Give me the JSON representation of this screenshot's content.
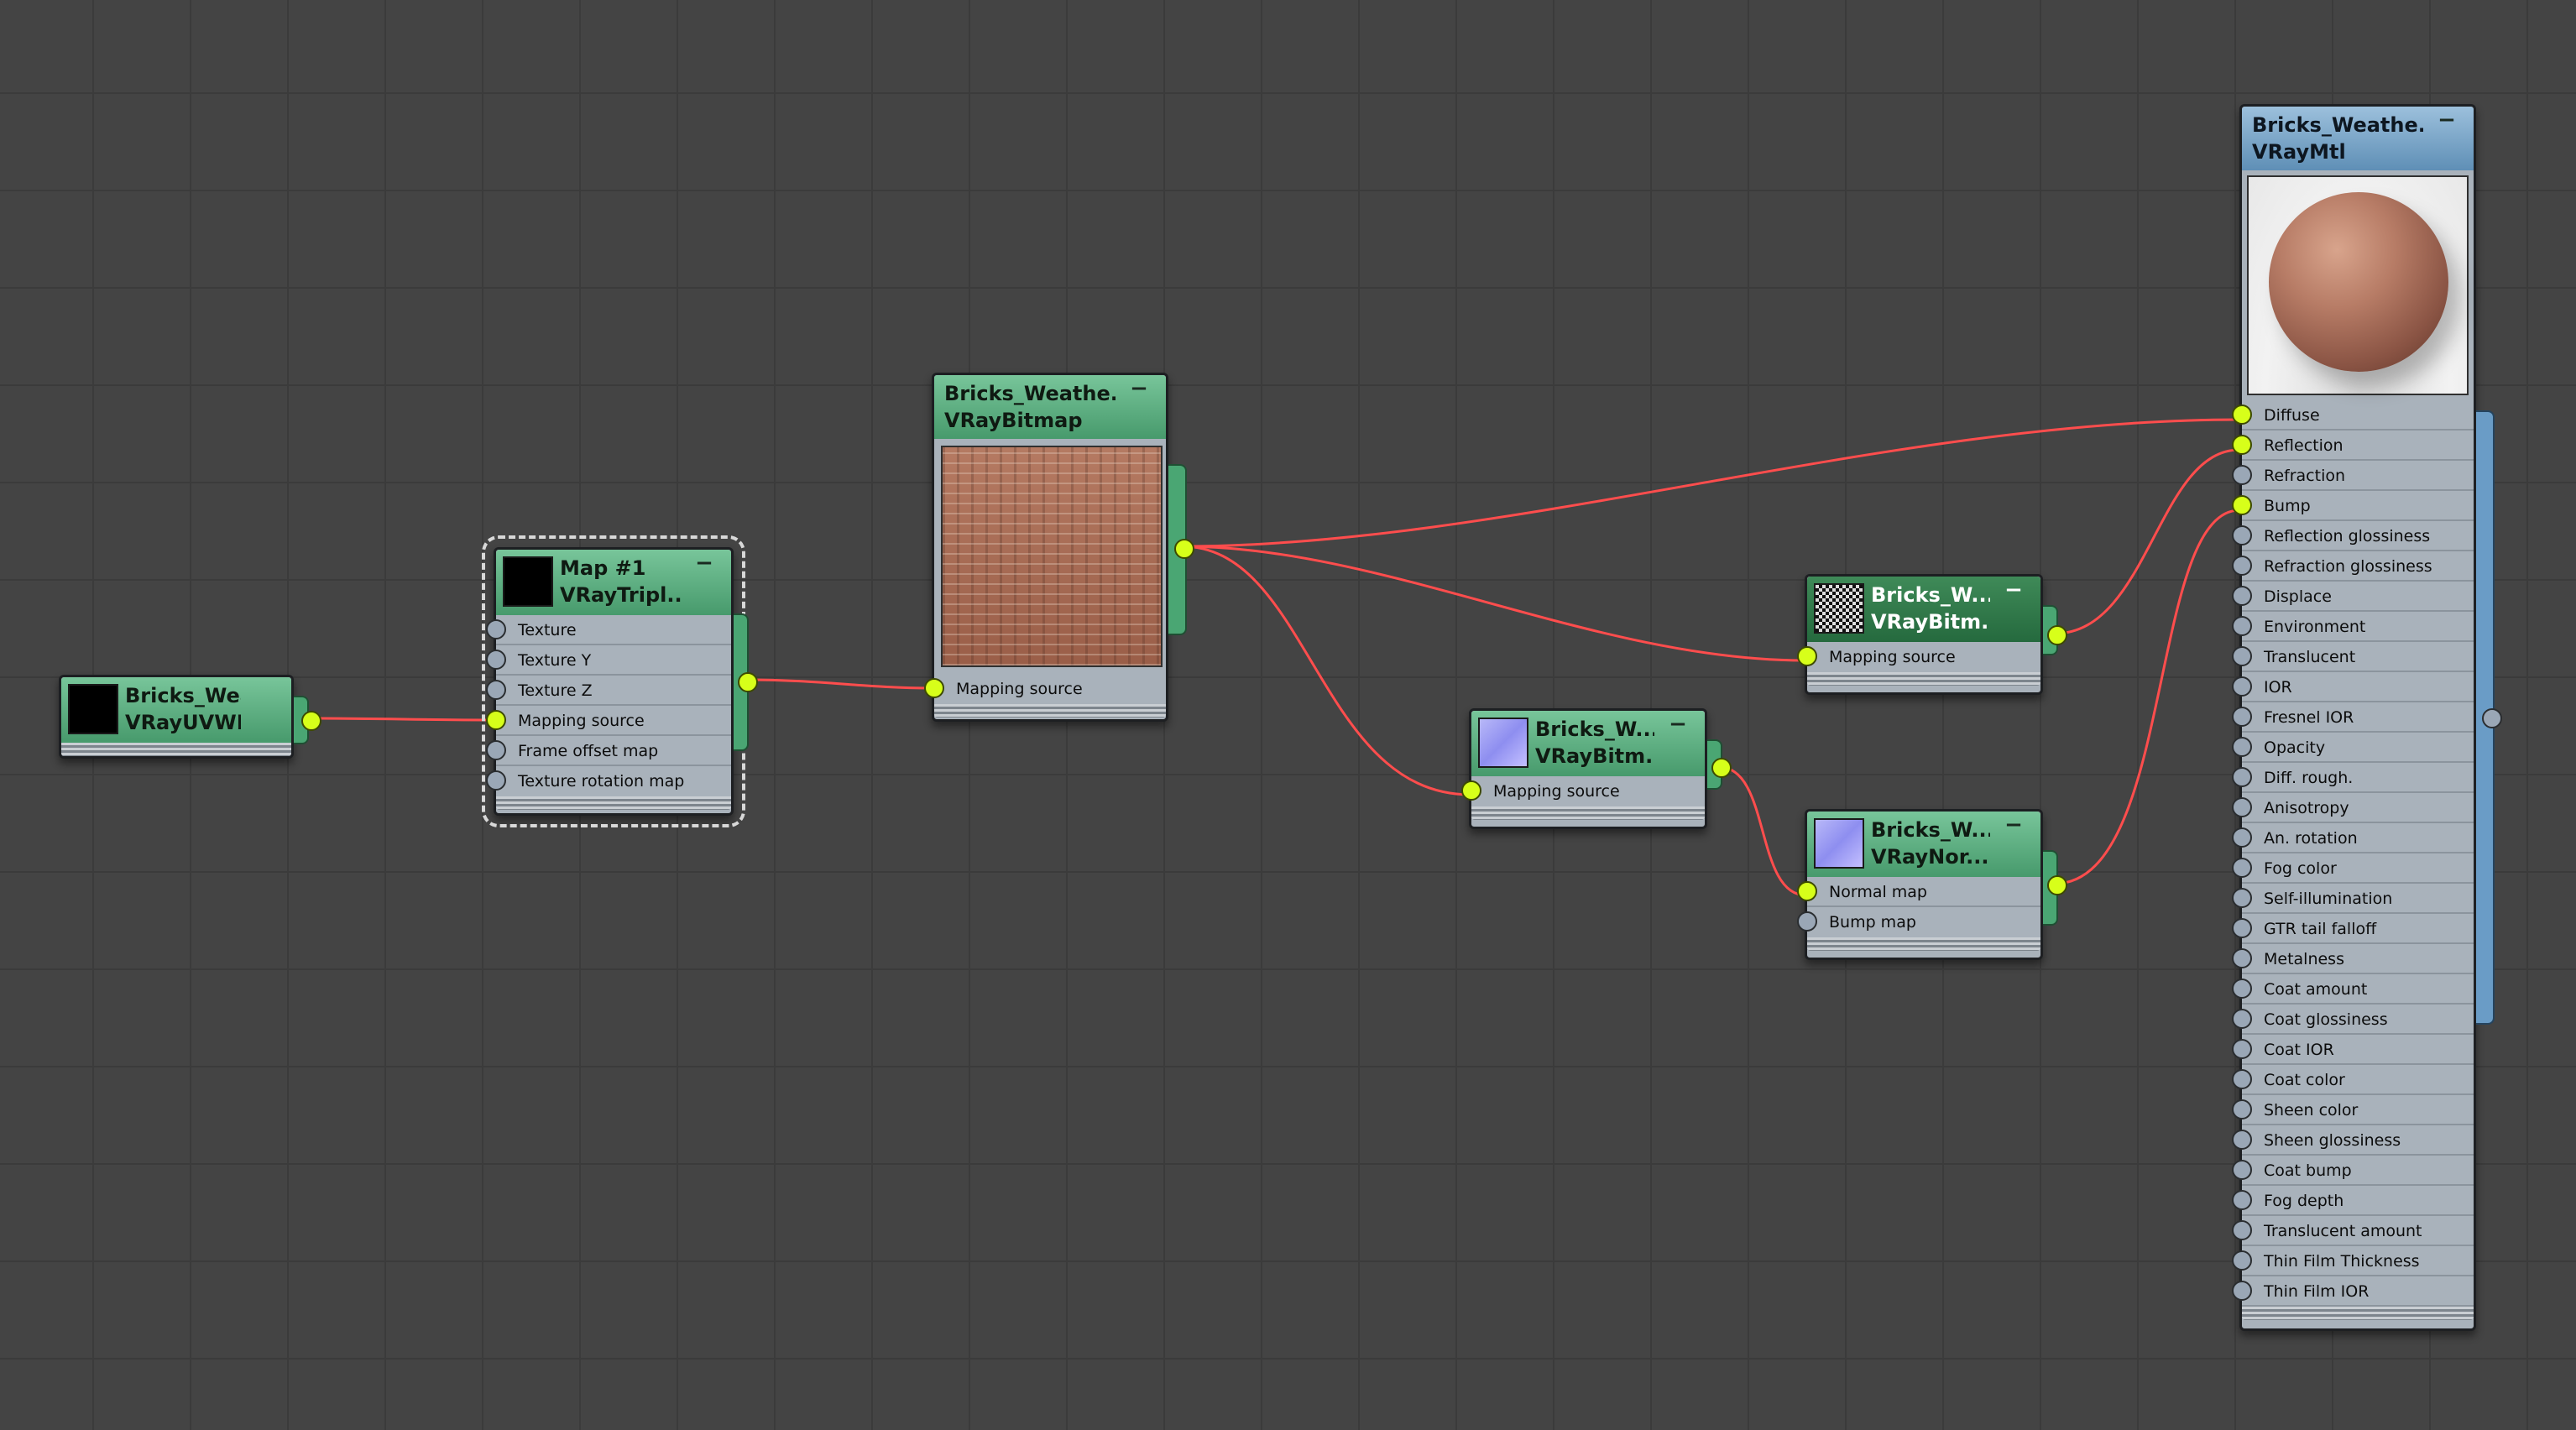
{
  "nodes": {
    "uvw": {
      "title": "Bricks_Weat...",
      "type": "VRayUVWRa..."
    },
    "triplanar": {
      "title": "Map #1",
      "type": "VRayTripl...",
      "slots": [
        "Texture",
        "Texture Y",
        "Texture Z",
        "Mapping source",
        "Frame offset map",
        "Texture rotation map"
      ]
    },
    "bitmap_main": {
      "title": "Bricks_Weathe...",
      "type": "VRayBitmap",
      "slots": [
        "Mapping source"
      ]
    },
    "bitmap_refl": {
      "title": "Bricks_W...",
      "type": "VRayBitm...",
      "slots": [
        "Mapping source"
      ]
    },
    "bitmap_normal": {
      "title": "Bricks_W...",
      "type": "VRayBitm...",
      "slots": [
        "Mapping source"
      ]
    },
    "normalmap": {
      "title": "Bricks_W...",
      "type": "VRayNor...",
      "slots": [
        "Normal map",
        "Bump map"
      ]
    },
    "material": {
      "title": "Bricks_Weathe...",
      "type": "VRayMtl",
      "slots": [
        "Diffuse",
        "Reflection",
        "Refraction",
        "Bump",
        "Reflection glossiness",
        "Refraction glossiness",
        "Displace",
        "Environment",
        "Translucent",
        "IOR",
        "Fresnel IOR",
        "Opacity",
        "Diff. rough.",
        "Anisotropy",
        "An. rotation",
        "Fog color",
        "Self-illumination",
        "GTR tail falloff",
        "Metalness",
        "Coat amount",
        "Coat glossiness",
        "Coat IOR",
        "Coat color",
        "Sheen color",
        "Sheen glossiness",
        "Coat bump",
        "Fog depth",
        "Translucent amount",
        "Thin Film Thickness",
        "Thin Film IOR"
      ]
    }
  },
  "colors": {
    "canvas": "#444444",
    "wire": "#ff4d4d",
    "port_connected": "#d7ff1a",
    "port_empty": "#9aa7b6",
    "map_header": "#5fb383",
    "material_header": "#7aa6cb"
  }
}
